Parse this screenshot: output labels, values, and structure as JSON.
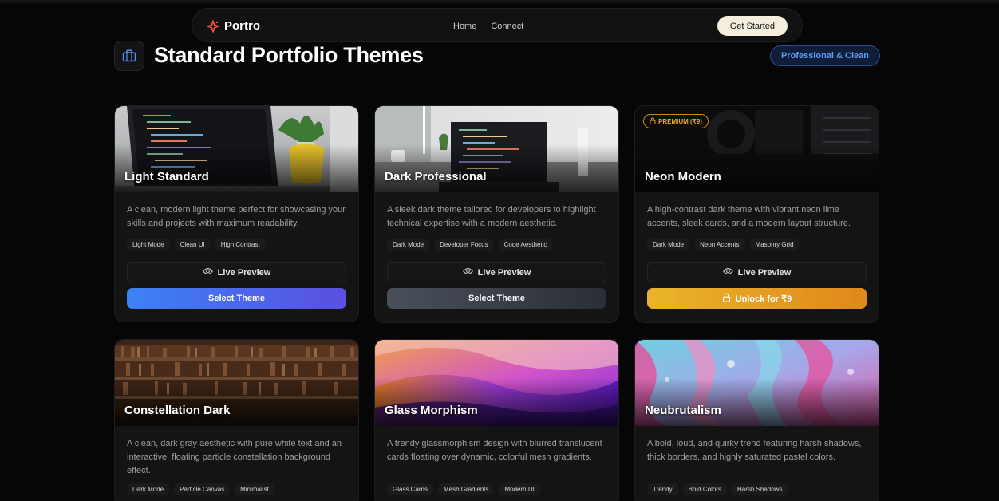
{
  "nav": {
    "brand": "Portro",
    "links": [
      "Home",
      "Connect"
    ],
    "cta": "Get Started"
  },
  "header": {
    "title": "Standard Portfolio Themes",
    "badge": "Professional & Clean"
  },
  "themes": [
    {
      "title": "Light Standard",
      "description": "A clean, modern light theme perfect for showcasing your skills and projects with maximum readability.",
      "tags": [
        "Light Mode",
        "Clean UI",
        "High Contrast"
      ],
      "preview_label": "Live Preview",
      "action_label": "Select Theme"
    },
    {
      "title": "Dark Professional",
      "description": "A sleek dark theme tailored for developers to highlight technical expertise with a modern aesthetic.",
      "tags": [
        "Dark Mode",
        "Developer Focus",
        "Code Aesthetic"
      ],
      "preview_label": "Live Preview",
      "action_label": "Select Theme"
    },
    {
      "title": "Neon Modern",
      "premium_badge": "PREMIUM (₹9)",
      "description": "A high-contrast dark theme with vibrant neon lime accents, sleek cards, and a modern layout structure.",
      "tags": [
        "Dark Mode",
        "Neon Accents",
        "Masonry Grid"
      ],
      "preview_label": "Live Preview",
      "action_label": "Unlock for ₹9"
    },
    {
      "title": "Constellation Dark",
      "description": "A clean, dark gray aesthetic with pure white text and an interactive, floating particle constellation background effect.",
      "tags": [
        "Dark Mode",
        "Particle Canvas",
        "Minimalist"
      ]
    },
    {
      "title": "Glass Morphism",
      "description": "A trendy glassmorphism design with blurred translucent cards floating over dynamic, colorful mesh gradients.",
      "tags": [
        "Glass Cards",
        "Mesh Gradients",
        "Modern UI"
      ]
    },
    {
      "title": "Neubrutalism",
      "description": "A bold, loud, and quirky trend featuring harsh shadows, thick borders, and highly saturated pastel colors.",
      "tags": [
        "Trendy",
        "Bold Colors",
        "Harsh Shadows"
      ]
    }
  ],
  "colors": {
    "accent_blue": "#3b82f6",
    "accent_gold": "#eab52a",
    "brand_icon": "#ff4d3d"
  },
  "icons": {
    "brand": "sparkle-icon",
    "header": "briefcase-icon",
    "preview": "eye-icon",
    "lock": "lock-icon"
  }
}
